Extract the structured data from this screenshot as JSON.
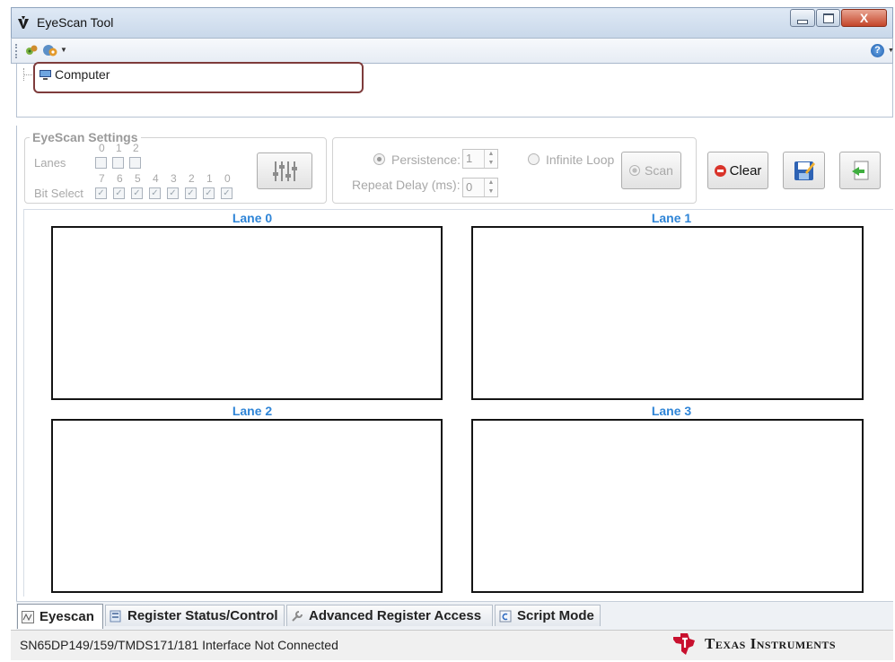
{
  "window": {
    "title": "EyeScan Tool",
    "close_glyph": "X"
  },
  "toolbar": {
    "help_glyph": "?"
  },
  "tree": {
    "root_label": "Computer"
  },
  "settings": {
    "group_title": "EyeScan Settings",
    "lanes_label": "Lanes",
    "lane_numbers": [
      "0",
      "1",
      "2"
    ],
    "bit_select_label": "Bit Select",
    "bit_numbers": [
      "7",
      "6",
      "5",
      "4",
      "3",
      "2",
      "1",
      "0"
    ]
  },
  "run": {
    "persistence_label": "Persistence:",
    "persistence_value": "1",
    "infinite_loop_label": "Infinite Loop",
    "repeat_delay_label": "Repeat Delay (ms):",
    "repeat_delay_value": "0",
    "scan_label": "Scan",
    "clear_label": "Clear"
  },
  "lanes": [
    {
      "title": "Lane 0"
    },
    {
      "title": "Lane 1"
    },
    {
      "title": "Lane 2"
    },
    {
      "title": "Lane 3"
    }
  ],
  "tabs": [
    {
      "label": "Eyescan",
      "icon": "eyescan-icon",
      "active": true
    },
    {
      "label": "Register Status/Control",
      "icon": "register-icon",
      "active": false
    },
    {
      "label": "Advanced Register Access",
      "icon": "wrench-icon",
      "active": false
    },
    {
      "label": "Script Mode",
      "icon": "script-icon",
      "active": false
    }
  ],
  "status": {
    "message": "SN65DP149/159/TMDS171/181 Interface Not Connected",
    "brand": "Texas Instruments"
  },
  "colors": {
    "lane_title": "#2f85d7",
    "highlight_border": "#7e3b3b",
    "clear_icon": "#d9342b",
    "ti_red": "#c8102e"
  }
}
